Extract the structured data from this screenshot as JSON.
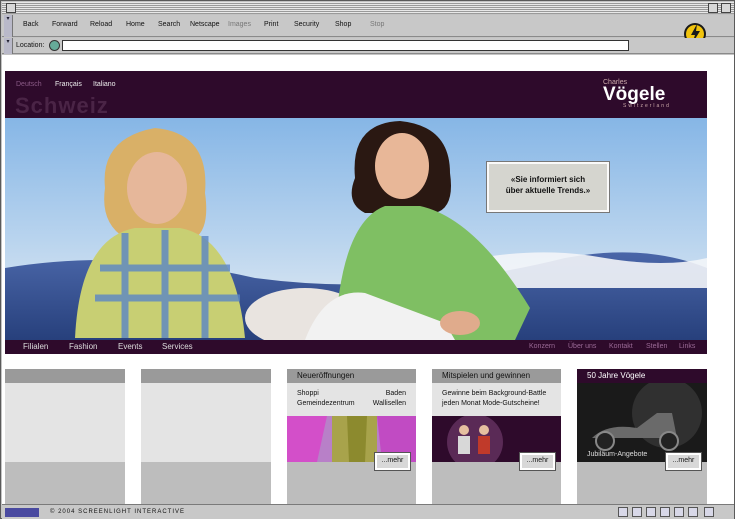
{
  "toolbar": {
    "back": "Back",
    "forward": "Forward",
    "reload": "Reload",
    "home": "Home",
    "search": "Search",
    "netscape": "Netscape",
    "images": "Images",
    "print": "Print",
    "security": "Security",
    "shop": "Shop",
    "stop": "Stop"
  },
  "location": {
    "label": "Location:",
    "value": ""
  },
  "header": {
    "languages": [
      "Deutsch",
      "Français",
      "Italiano"
    ],
    "region": "Schweiz",
    "brand_small": "Charles",
    "brand": "Vögele",
    "brand_sub": "Switzerland"
  },
  "hero": {
    "bubble_line1": "«Sie informiert sich",
    "bubble_line2": "über aktuelle Trends.»"
  },
  "nav": {
    "main": [
      "Filialen",
      "Fashion",
      "Events",
      "Services"
    ],
    "secondary": [
      "Konzern",
      "Über uns",
      "Kontakt",
      "Stellen",
      "Links"
    ]
  },
  "teasers": {
    "neu": {
      "title": "Neueröffnungen",
      "left1": "Shoppi",
      "right1": "Baden",
      "left2": "Gemeindezentrum",
      "right2": "Wallisellen",
      "more": "...mehr"
    },
    "mit": {
      "title": "Mitspielen und gewinnen",
      "line1": "Gewinne beim Background-Battle",
      "line2": "jeden Monat Mode-Gutscheine!",
      "more": "...mehr"
    },
    "jahre": {
      "title": "50 Jahre Vögele",
      "caption": "Jubiläum-Angebote",
      "more": "...mehr"
    }
  },
  "status": {
    "text": "© 2004 SCREENLIGHT INTERACTIVE"
  }
}
